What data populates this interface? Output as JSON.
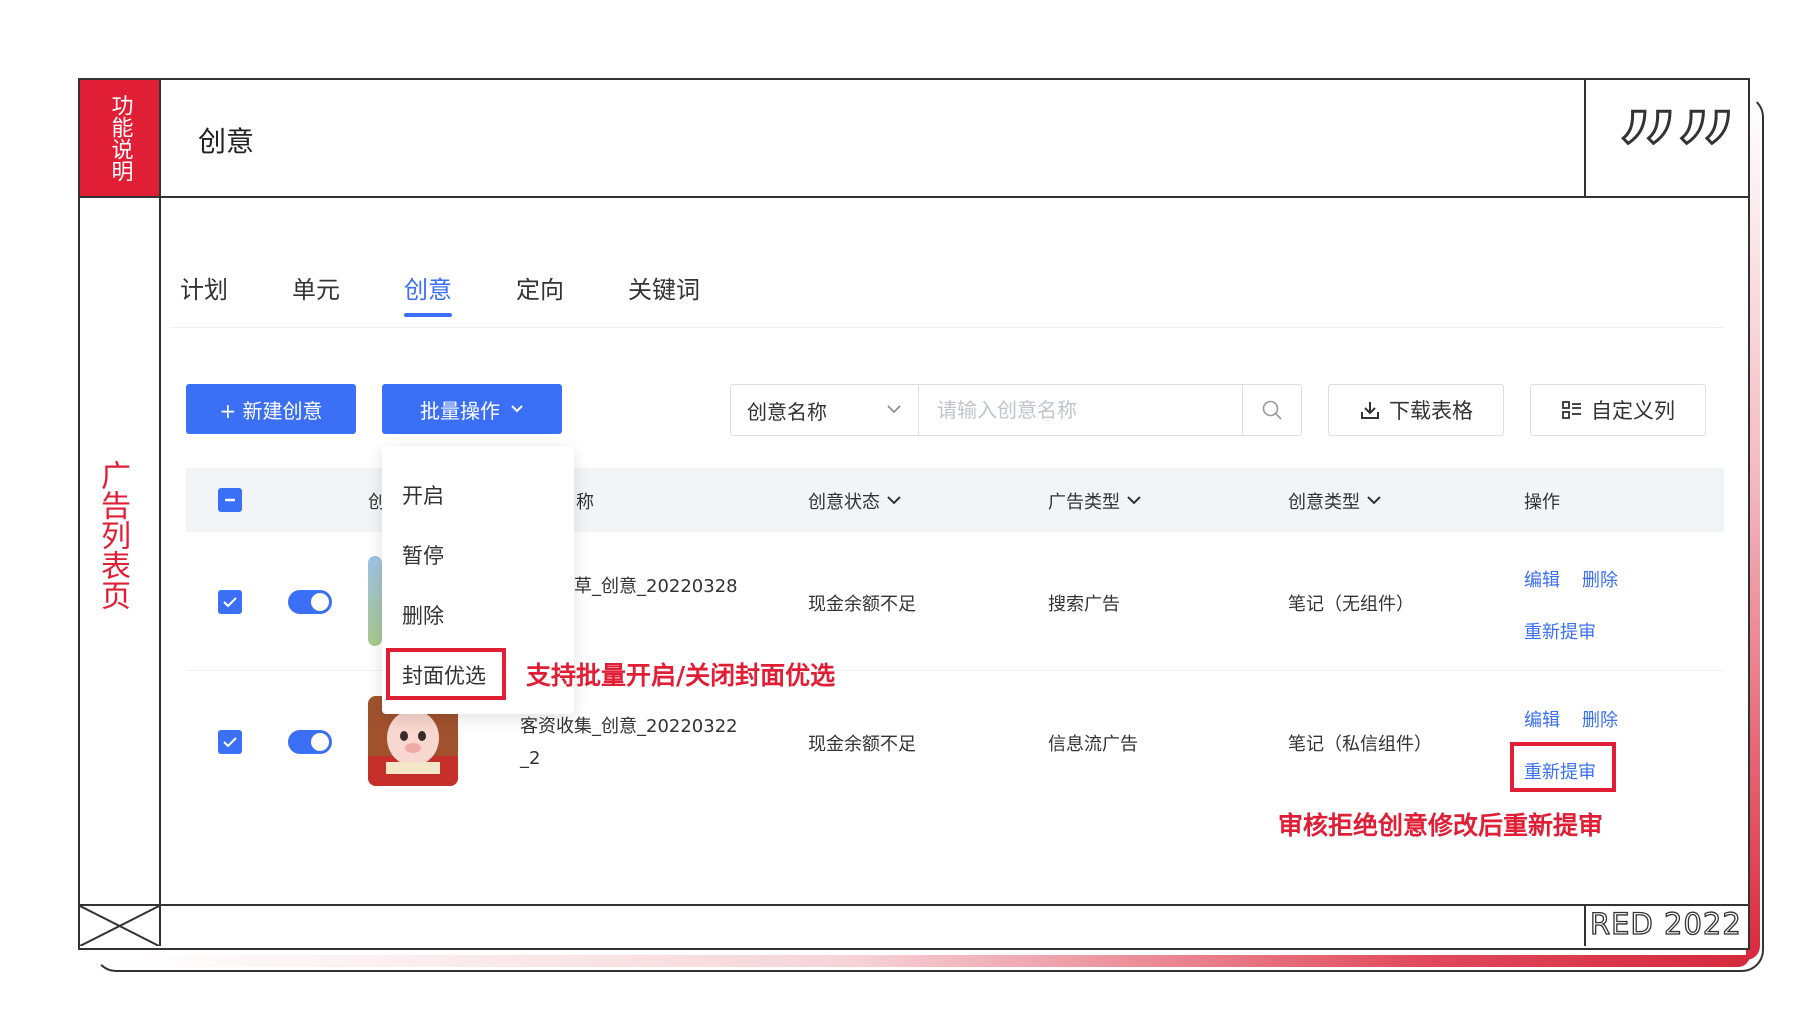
{
  "slide": {
    "corner_tag": "功能说明",
    "side_label": "广告列表页",
    "header_title": "创意",
    "quote_glyph": "”",
    "footer_brand": "RED 2022"
  },
  "tabs": [
    "计划",
    "单元",
    "创意",
    "定向",
    "关键词"
  ],
  "active_tab": "创意",
  "toolbar": {
    "new_button": "+ 新建创意",
    "batch_button": "批量操作",
    "search_field_select": "创意名称",
    "search_placeholder": "请输入创意名称",
    "download_button": "下载表格",
    "custom_columns_button": "自定义列"
  },
  "dropdown": {
    "items": [
      "开启",
      "暂停",
      "删除",
      "封面优选"
    ],
    "highlighted": "封面优选"
  },
  "table": {
    "columns": [
      "创",
      "称",
      "创意状态",
      "广告类型",
      "创意类型",
      "操作"
    ],
    "rows": [
      {
        "checked": true,
        "enabled": true,
        "name_line1": "草_创意_20220328",
        "name_line2": "",
        "status": "现金余额不足",
        "ad_type": "搜索广告",
        "creative_type": "笔记（无组件）",
        "actions": [
          "编辑",
          "删除",
          "重新提审"
        ]
      },
      {
        "checked": true,
        "enabled": true,
        "name_line1": "客资收集_创意_20220322",
        "name_line2": "_2",
        "status": "现金余额不足",
        "ad_type": "信息流广告",
        "creative_type": "笔记（私信组件）",
        "actions": [
          "编辑",
          "删除",
          "重新提审"
        ]
      }
    ]
  },
  "annotations": {
    "cover_note": "支持批量开启/关闭封面优选",
    "resubmit_note": "审核拒绝创意修改后重新提审"
  },
  "colors": {
    "accent_red": "#e01f36",
    "primary_blue": "#3b6ff5"
  }
}
